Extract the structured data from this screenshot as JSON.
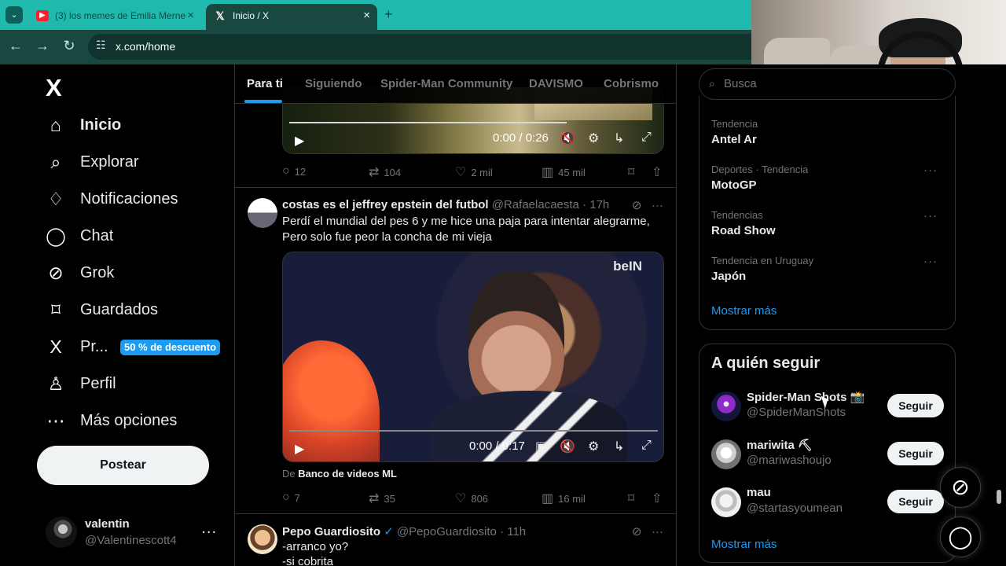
{
  "browser": {
    "tabs": [
      {
        "title": "(3) los memes de Emilia Merne",
        "icon": "youtube-icon"
      },
      {
        "title": "Inicio / X",
        "icon": "x-logo-icon"
      }
    ],
    "new_tab": "+",
    "url": "x.com/home"
  },
  "sidebar": {
    "logo": "X",
    "items": [
      {
        "label": "Inicio",
        "icon": "home-icon"
      },
      {
        "label": "Explorar",
        "icon": "search-icon"
      },
      {
        "label": "Notificaciones",
        "icon": "bell-icon"
      },
      {
        "label": "Chat",
        "icon": "chat-icon"
      },
      {
        "label": "Grok",
        "icon": "grok-icon"
      },
      {
        "label": "Guardados",
        "icon": "bookmark-icon"
      },
      {
        "label": "Pr...",
        "icon": "x-premium-icon"
      },
      {
        "label": "Perfil",
        "icon": "profile-icon"
      },
      {
        "label": "Más opciones",
        "icon": "more-circle-icon"
      }
    ],
    "promo": "50 % de descuento",
    "post_button": "Postear",
    "profile": {
      "name": "valentin",
      "handle": "@Valentinescott4",
      "more": "..."
    }
  },
  "feed": {
    "tabs": [
      "Para ti",
      "Siguiendo",
      "Spider-Man Community",
      "DAVISMO",
      "Cobrismo"
    ],
    "first_video": {
      "time": "0:00 / 0:26",
      "progress": 0.73
    },
    "first_actions": {
      "replies": "12",
      "reposts": "104",
      "likes": "2 mil",
      "views": "45 mil"
    },
    "tweets": [
      {
        "name": "costas es el jeffrey epstein del futbol",
        "handle": "@Rafaelacaesta",
        "time": "· 17h",
        "text": "Perdí el mundial del pes 6 y me hice una paja para intentar alegrarme, Pero solo fue peor la concha de mi vieja",
        "video_time": "0:00 / 0:17",
        "video_logo": "beIN",
        "video_progress": 0.0,
        "source_prefix": "De",
        "source": "Banco de videos ML",
        "replies": "7",
        "reposts": "35",
        "likes": "806",
        "views": "16 mil"
      },
      {
        "name": "Pepo Guardiosito",
        "handle": "@PepoGuardiosito",
        "time": "· 11h",
        "text_lines": [
          "-arranco yo?",
          "-si cobrita"
        ]
      }
    ]
  },
  "right": {
    "search_placeholder": "Busca",
    "trends": [
      {
        "category": "Tendencia",
        "title": "Antel Ar"
      },
      {
        "category": "Deportes · Tendencia",
        "title": "MotoGP"
      },
      {
        "category": "Tendencias",
        "title": "Road Show"
      },
      {
        "category": "Tendencia en Uruguay",
        "title": "Japón"
      }
    ],
    "show_more": "Mostrar más",
    "who_title": "A quién seguir",
    "who": [
      {
        "name": "Spider-Man Shots 📸",
        "handle": "@SpiderManShots",
        "button": "Seguir"
      },
      {
        "name": "mariwita ⛏",
        "handle": "@mariwashoujo",
        "button": "Seguir"
      },
      {
        "name": "mau",
        "handle": "@startasyoumean",
        "button": "Seguir"
      }
    ],
    "who_show_more": "Mostrar más"
  },
  "colors": {
    "accent": "#1d9bf0",
    "background": "#000000",
    "browser": "#1fb9ae"
  }
}
